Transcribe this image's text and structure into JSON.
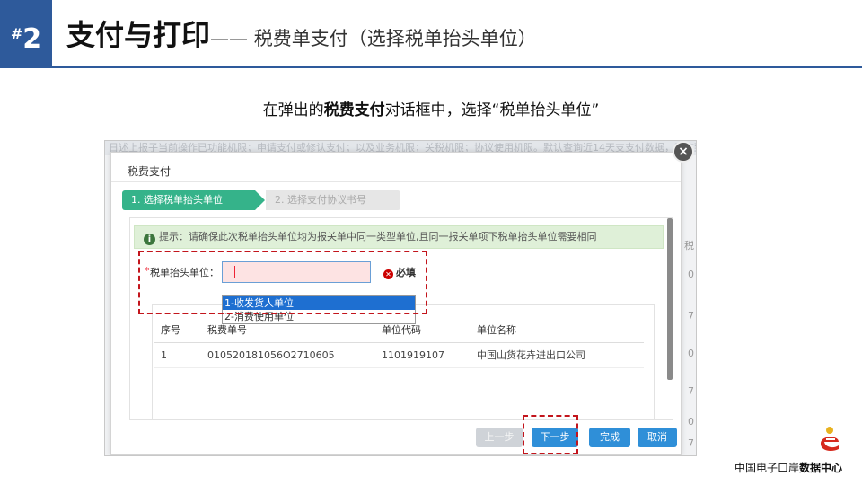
{
  "header": {
    "badge": "2",
    "badge_hash": "#",
    "title": "支付与打印",
    "subtitle": "—— 税费单支付（选择税单抬头单位）"
  },
  "caption": {
    "prefix": "在弹出的",
    "bold": "税费支付",
    "suffix": "对话框中，选择“税单抬头单位”"
  },
  "background": {
    "strip_text": "日述上报子当前操作已功能机限；申请支付或修认支付；以及业务机限；关税机限；协议使用机限。默认查询近14天支支付数据，需这致",
    "side_marks": [
      "税",
      "0",
      "7",
      "0",
      "7",
      "0",
      "7"
    ]
  },
  "dialog": {
    "title": "税费支付",
    "close_symbol": "×",
    "steps": [
      "1. 选择税单抬头单位",
      "2. 选择支付协议书号"
    ],
    "tip": "提示：请确保此次税单抬头单位均为报关单中同一类型单位,且同一报关单项下税单抬头单位需要相同",
    "field_label": "税单抬头单位：",
    "field_value": "",
    "required_star": "*",
    "required_hint": "必填",
    "options": [
      "1-收发货人单位",
      "2-消费使用单位"
    ],
    "table": {
      "headers": [
        "序号",
        "税费单号",
        "单位代码",
        "单位名称"
      ],
      "rows": [
        [
          "1",
          "010520181056O2710605",
          "1101919107",
          "中国山货花卉进出口公司"
        ]
      ]
    },
    "buttons": {
      "prev": "上一步",
      "next": "下一步",
      "done": "完成",
      "cancel": "取消"
    }
  },
  "footer": {
    "text_normal": "中国电子口岸",
    "text_bold": "数据中心"
  },
  "colors": {
    "accent_blue": "#2e5a9b",
    "step_active": "#35b38a",
    "button_blue": "#2f8fd8",
    "highlight_red": "#c3151c"
  }
}
